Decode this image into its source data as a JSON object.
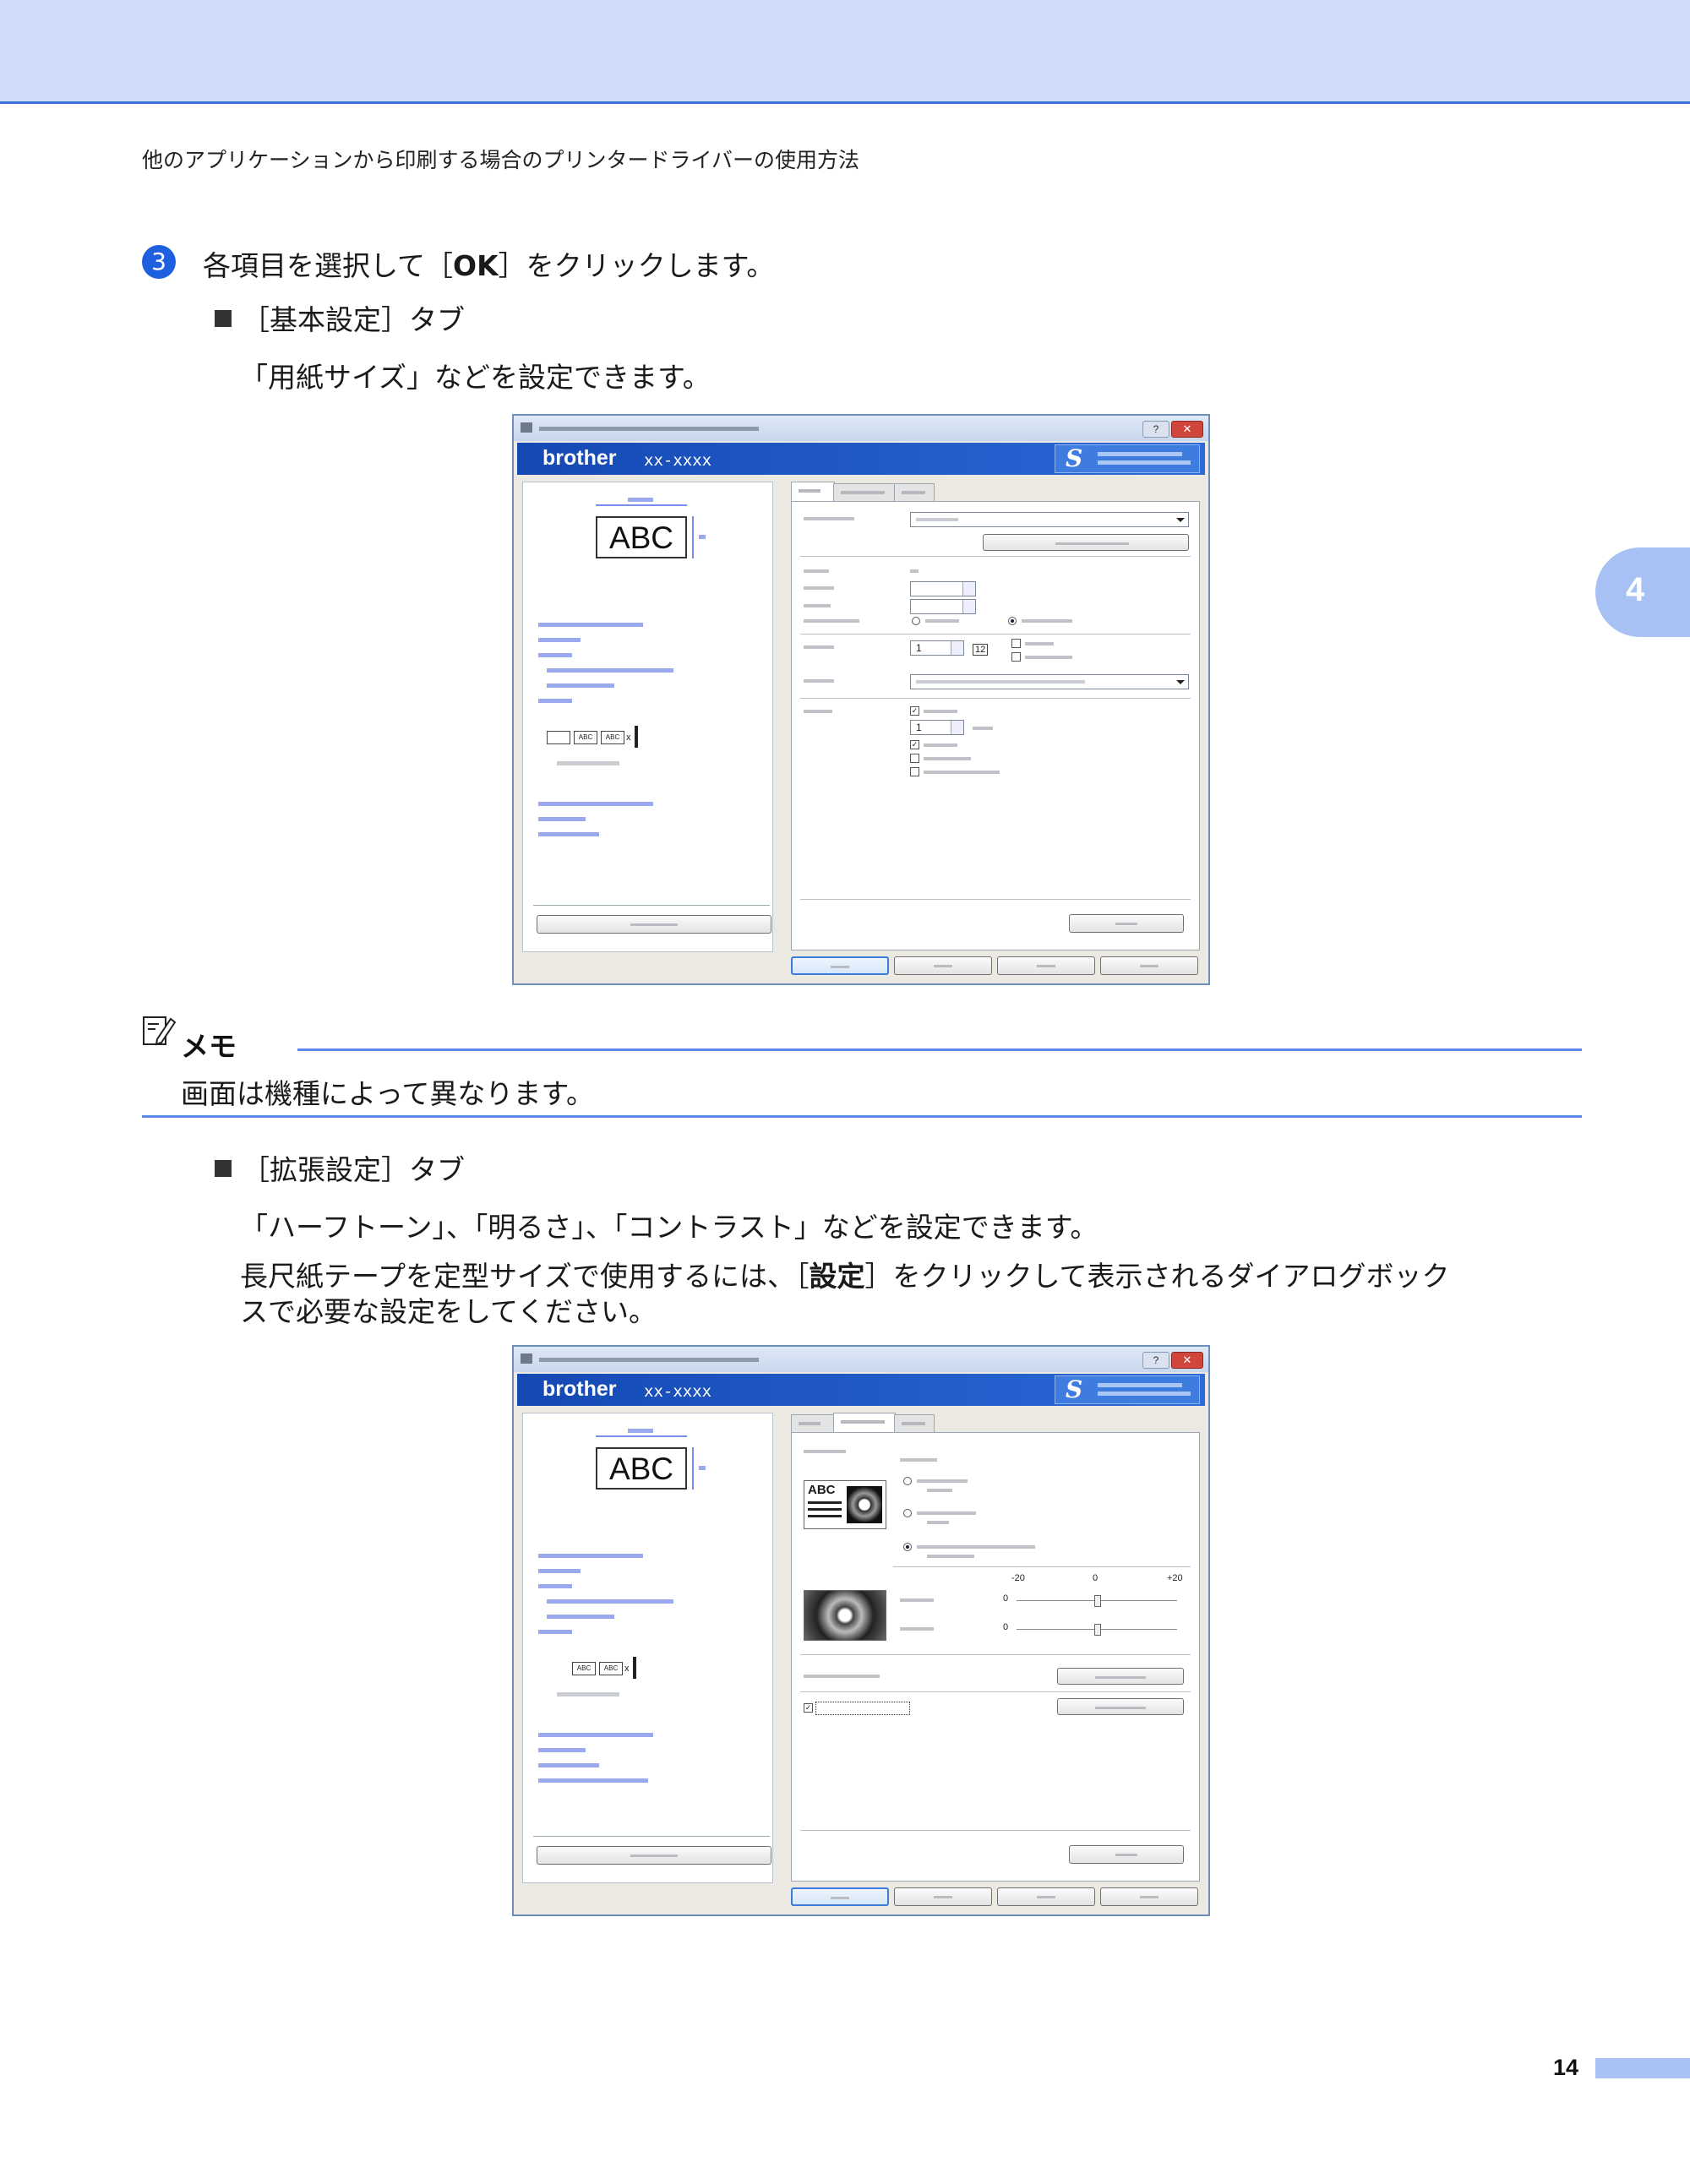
{
  "header": {
    "title": "他のアプリケーションから印刷する場合のプリンタードライバーの使用方法"
  },
  "chapter_tab": "4",
  "step": {
    "number": "3",
    "text_before": "各項目を選択して［",
    "text_bold": "OK",
    "text_after": "］をクリックします。"
  },
  "section_basic": {
    "label_open": "［",
    "label": "基本設定",
    "label_close": "］タブ",
    "description": "「用紙サイズ」などを設定できます。"
  },
  "dialog": {
    "brand": "brother",
    "model": "xx-xxxx",
    "badge_mark": "S",
    "preview_text": "ABC",
    "preview_small_text": "ABC",
    "cut_mark": "x",
    "close_glyph": "✕",
    "help_glyph": "?",
    "copies_value": "1",
    "labels_value": "1",
    "collate_icon": "12",
    "brightness_scale": [
      "-20",
      "0",
      "+20"
    ],
    "brightness_value": "0",
    "contrast_value": "0",
    "check_mark": "✓"
  },
  "note": {
    "title": "メモ",
    "text": "画面は機種によって異なります。"
  },
  "section_advanced": {
    "label_open": "［",
    "label": "拡張設定",
    "label_close": "］タブ",
    "description1": "「ハーフトーン」、「明るさ」、「コントラスト」などを設定できます。",
    "description2_before": "長尺紙テープを定型サイズで使用するには、［",
    "description2_bold": "設定",
    "description2_after": "］をクリックして表示されるダイアログボック",
    "description2_line2": "スで必要な設定をしてください。"
  },
  "footer": {
    "page_number": "14"
  },
  "colors": {
    "header_band": "#cfdcfc",
    "accent_blue": "#1e5fe0",
    "rule_blue": "#5a8ae6",
    "tab_blue": "#a7c1f4"
  }
}
